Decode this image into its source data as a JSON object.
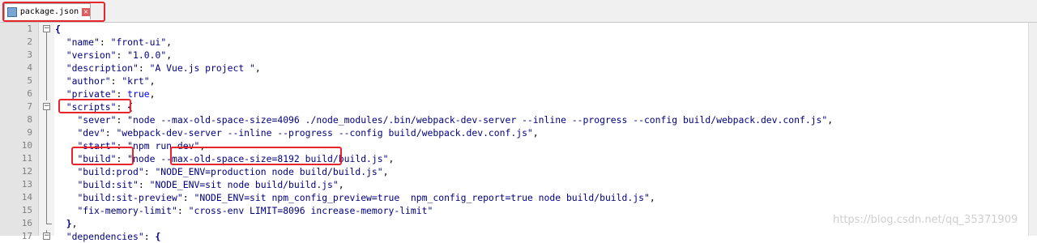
{
  "tab": {
    "title": "package.json",
    "close_glyph": "×"
  },
  "icons": {
    "file": "file-icon",
    "close": "close-icon",
    "fold": "fold-minus-icon"
  },
  "watermark": "https://blog.csdn.net/qq_35371909",
  "lines": [
    {
      "n": "1",
      "parts": [
        [
          "p",
          "{"
        ]
      ]
    },
    {
      "n": "2",
      "parts": [
        [
          "t",
          "  "
        ],
        [
          "k",
          "\"name\""
        ],
        [
          "t",
          ": "
        ],
        [
          "s",
          "\"front-ui\""
        ],
        [
          "t",
          ","
        ]
      ]
    },
    {
      "n": "3",
      "parts": [
        [
          "t",
          "  "
        ],
        [
          "k",
          "\"version\""
        ],
        [
          "t",
          ": "
        ],
        [
          "s",
          "\"1.0.0\""
        ],
        [
          "t",
          ","
        ]
      ]
    },
    {
      "n": "4",
      "parts": [
        [
          "t",
          "  "
        ],
        [
          "k",
          "\"description\""
        ],
        [
          "t",
          ": "
        ],
        [
          "s",
          "\"A Vue.js project \""
        ],
        [
          "t",
          ","
        ]
      ]
    },
    {
      "n": "5",
      "parts": [
        [
          "t",
          "  "
        ],
        [
          "k",
          "\"author\""
        ],
        [
          "t",
          ": "
        ],
        [
          "s",
          "\"krt\""
        ],
        [
          "t",
          ","
        ]
      ]
    },
    {
      "n": "6",
      "parts": [
        [
          "t",
          "  "
        ],
        [
          "k",
          "\"private\""
        ],
        [
          "t",
          ": "
        ],
        [
          "b",
          "true"
        ],
        [
          "t",
          ","
        ]
      ]
    },
    {
      "n": "7",
      "parts": [
        [
          "t",
          "  "
        ],
        [
          "k",
          "\"scripts\""
        ],
        [
          "t",
          ": "
        ],
        [
          "p",
          "{"
        ]
      ]
    },
    {
      "n": "8",
      "parts": [
        [
          "t",
          "    "
        ],
        [
          "k",
          "\"sever\""
        ],
        [
          "t",
          ": "
        ],
        [
          "s",
          "\"node --max-old-space-size=4096 ./node_modules/.bin/webpack-dev-server --inline --progress --config build/webpack.dev.conf.js\""
        ],
        [
          "t",
          ","
        ]
      ]
    },
    {
      "n": "9",
      "parts": [
        [
          "t",
          "    "
        ],
        [
          "k",
          "\"dev\""
        ],
        [
          "t",
          ": "
        ],
        [
          "s",
          "\"webpack-dev-server --inline --progress --config build/webpack.dev.conf.js\""
        ],
        [
          "t",
          ","
        ]
      ]
    },
    {
      "n": "10",
      "parts": [
        [
          "t",
          "    "
        ],
        [
          "k",
          "\"start\""
        ],
        [
          "t",
          ": "
        ],
        [
          "s",
          "\"npm run dev\""
        ],
        [
          "t",
          ","
        ]
      ]
    },
    {
      "n": "11",
      "parts": [
        [
          "t",
          "    "
        ],
        [
          "k",
          "\"build\""
        ],
        [
          "t",
          ": "
        ],
        [
          "s",
          "\"node --max-old-space-size=8192 build/build.js\""
        ],
        [
          "t",
          ","
        ]
      ]
    },
    {
      "n": "12",
      "parts": [
        [
          "t",
          "    "
        ],
        [
          "k",
          "\"build:prod\""
        ],
        [
          "t",
          ": "
        ],
        [
          "s",
          "\"NODE_ENV=production node build/build.js\""
        ],
        [
          "t",
          ","
        ]
      ]
    },
    {
      "n": "13",
      "parts": [
        [
          "t",
          "    "
        ],
        [
          "k",
          "\"build:sit\""
        ],
        [
          "t",
          ": "
        ],
        [
          "s",
          "\"NODE_ENV=sit node build/build.js\""
        ],
        [
          "t",
          ","
        ]
      ]
    },
    {
      "n": "14",
      "parts": [
        [
          "t",
          "    "
        ],
        [
          "k",
          "\"build:sit-preview\""
        ],
        [
          "t",
          ": "
        ],
        [
          "s",
          "\"NODE_ENV=sit npm_config_preview=true  npm_config_report=true node build/build.js\""
        ],
        [
          "t",
          ","
        ]
      ]
    },
    {
      "n": "15",
      "parts": [
        [
          "t",
          "    "
        ],
        [
          "k",
          "\"fix-memory-limit\""
        ],
        [
          "t",
          ": "
        ],
        [
          "s",
          "\"cross-env LIMIT=8096 increase-memory-limit\""
        ]
      ]
    },
    {
      "n": "16",
      "parts": [
        [
          "t",
          "  "
        ],
        [
          "p",
          "}"
        ],
        [
          "t",
          ","
        ]
      ]
    },
    {
      "n": "17",
      "parts": [
        [
          "t",
          "  "
        ],
        [
          "k",
          "\"dependencies\""
        ],
        [
          "t",
          ": "
        ],
        [
          "p",
          "{"
        ]
      ]
    }
  ]
}
